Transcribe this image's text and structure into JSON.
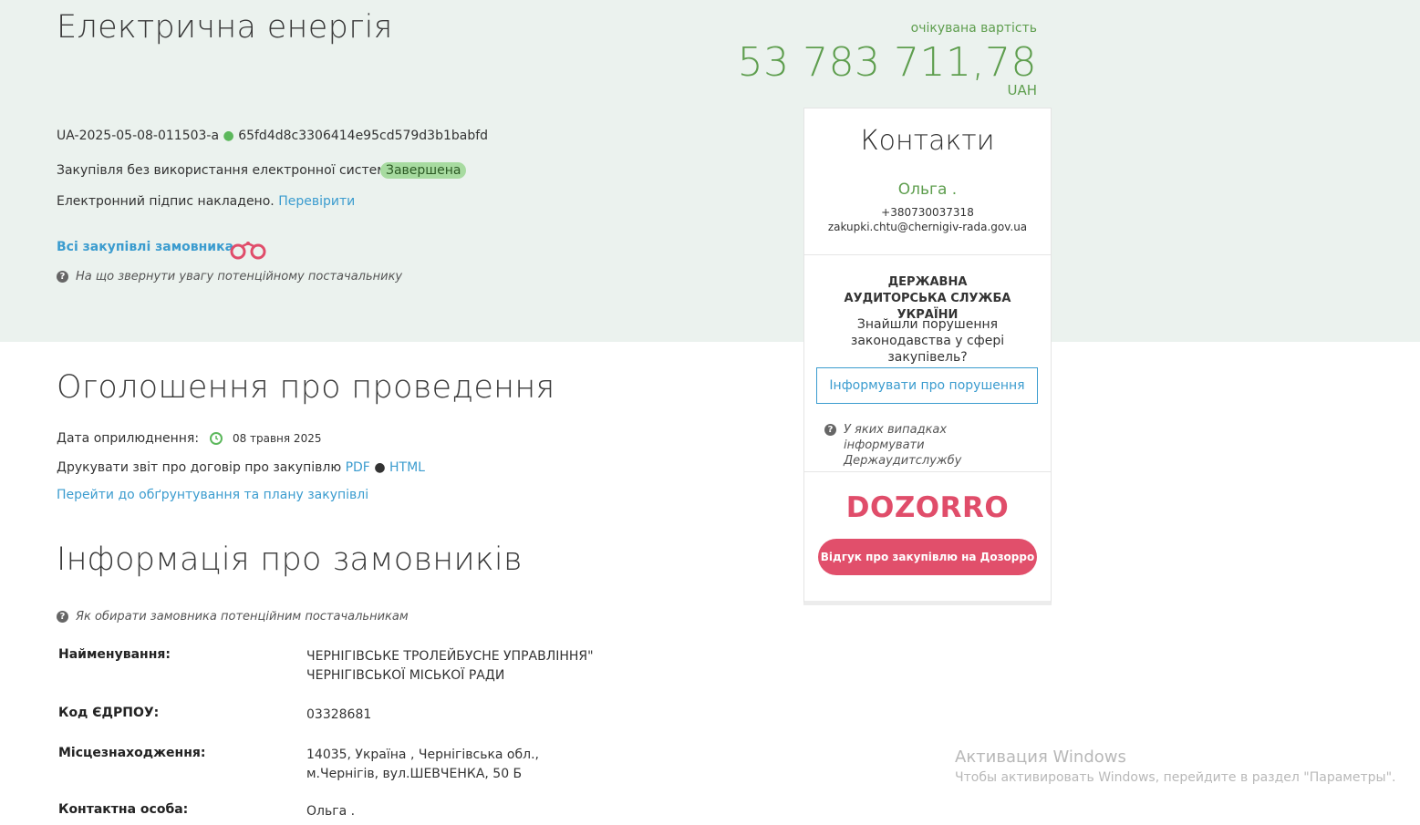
{
  "header": {
    "title": "Електрична енергія",
    "price_label": "очікувана вартість",
    "price_value": "53 783 711,78",
    "currency": "UAH",
    "tender_id": "UA-2025-05-08-011503-a",
    "tender_hash": "65fd4d8c3306414e95cd579d3b1babfd",
    "procedure_type": "Закупівля без використання електронної системи",
    "status": "Завершена",
    "signature_text": "Електронний підпис накладено.",
    "verify_link": "Перевірити",
    "all_purchases_link": "Всі закупівлі замовника",
    "attention_hint": "На що звернути увагу потенційному постачальнику"
  },
  "announcement": {
    "title": "Оголошення про проведення",
    "date_label": "Дата оприлюднення:",
    "date_value": "08 травня 2025",
    "print_text": "Друкувати звіт про договір про закупівлю",
    "pdf_link": "PDF",
    "html_link": "HTML",
    "plan_link": "Перейти до обґрунтування та плану закупівлі"
  },
  "customers": {
    "title": "Інформація про замовників",
    "hint": "Як обирати замовника потенційним постачальникам",
    "rows": [
      {
        "key": "Найменування:",
        "value": "ЧЕРНІГІВСЬКЕ ТРОЛЕЙБУСНЕ УПРАВЛІННЯ\" ЧЕРНІГІВСЬКОЇ МІСЬКОЇ РАДИ"
      },
      {
        "key": "Код ЄДРПОУ:",
        "value": "03328681"
      },
      {
        "key": "Місцезнаходження:",
        "value": "14035, Україна , Чернігівська обл., м.Чернігів, вул.ШЕВЧЕНКА, 50 Б"
      },
      {
        "key": "Контактна особа:",
        "value": "Ольга ."
      }
    ]
  },
  "contacts": {
    "title": "Контакти",
    "name": "Ольга .",
    "phone": "+380730037318",
    "email": "zakupki.chtu@chernigiv-rada.gov.ua",
    "audit_title": "ДЕРЖАВНА АУДИТОРСЬКА СЛУЖБА УКРАЇНИ",
    "audit_question": "Знайшли порушення законодавства у сфері закупівель?",
    "inform_button": "Інформувати про порушення",
    "audit_hint": "У яких випадках інформувати Держаудитслужбу",
    "dozorro_logo": "DOZORRO",
    "dozorro_button": "Відгук про закупівлю на Дозорро"
  },
  "windows_activation": {
    "title": "Активация Windows",
    "subtitle": "Чтобы активировать Windows, перейдите в раздел \"Параметры\"."
  },
  "colors": {
    "hero_bg": "#ebf2ee",
    "price_green": "#5e9e4e",
    "link_blue": "#3b9ccf",
    "dozorro_red": "#e14f6b",
    "status_badge": "#a7dba0"
  }
}
